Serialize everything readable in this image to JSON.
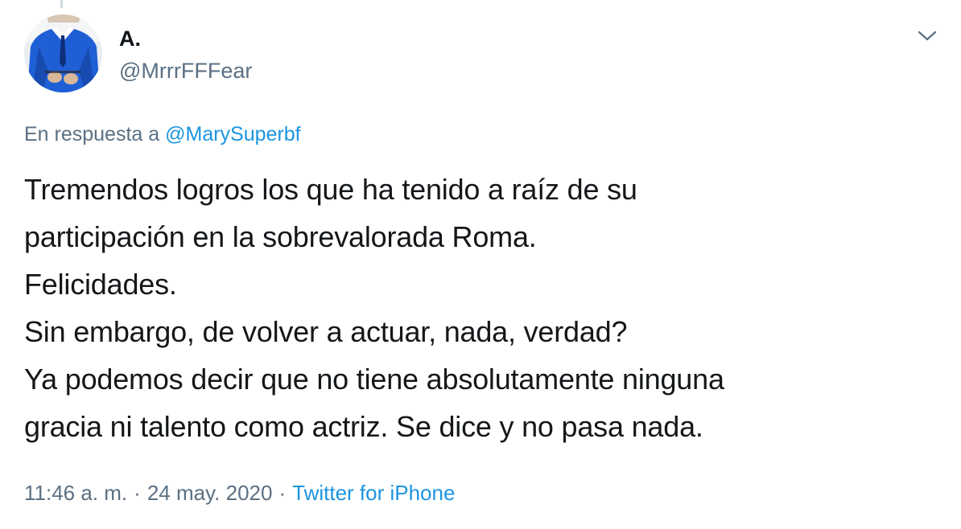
{
  "tweet": {
    "author": {
      "display_name": "A.",
      "handle": "@MrrrFFFear"
    },
    "reply": {
      "prefix": "En respuesta a",
      "mention": "@MarySuperbf"
    },
    "text_lines": [
      "Tremendos logros los que ha tenido a raíz de su",
      "participación en la sobrevalorada Roma.",
      "Felicidades.",
      "Sin embargo, de volver a actuar, nada, verdad?",
      "Ya podemos decir que no tiene absolutamente ninguna",
      "gracia ni talento como actriz. Se dice y no pasa nada."
    ],
    "meta": {
      "time": "11:46 a. m.",
      "separator": "·",
      "date": "24 may. 2020",
      "source": "Twitter for iPhone"
    }
  },
  "icons": {
    "menu": "chevron-down-icon"
  },
  "colors": {
    "link": "#1b95e0",
    "secondary_text": "#5b7083",
    "primary_text": "#14171a"
  }
}
